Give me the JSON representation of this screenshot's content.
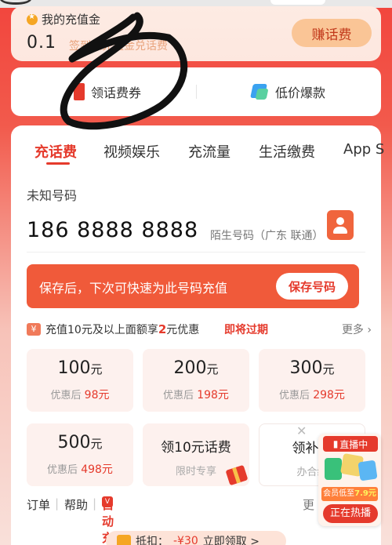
{
  "wallet": {
    "title": "我的充值金",
    "amount": "0.1",
    "hint": "签到领充值金兑话费",
    "earn_button": "赚话费"
  },
  "quick_links": [
    {
      "label": "领话费券",
      "icon": "coupon-icon"
    },
    {
      "label": "低价爆款",
      "icon": "deals-icon"
    }
  ],
  "tabs": [
    "充话费",
    "视频娱乐",
    "充流量",
    "生活缴费",
    "App S"
  ],
  "active_tab": 0,
  "phone": {
    "label": "未知号码",
    "number": "186 8888 8888",
    "carrier": "陌生号码（广东 联通）"
  },
  "save_banner": {
    "text": "保存后，下次可快速为此号码充值",
    "button": "保存号码"
  },
  "promo": {
    "tag": "¥",
    "text_before": "充值10元及以上面额享",
    "highlight": "2",
    "text_after": "元优惠",
    "expire": "即将过期",
    "more": "更多"
  },
  "amounts": [
    {
      "value": "100",
      "unit": "元",
      "sub_label": "优惠后",
      "price": "98元"
    },
    {
      "value": "200",
      "unit": "元",
      "sub_label": "优惠后",
      "price": "198元"
    },
    {
      "value": "300",
      "unit": "元",
      "sub_label": "优惠后",
      "price": "298元"
    },
    {
      "value": "500",
      "unit": "元",
      "sub_label": "优惠后",
      "price": "498元"
    }
  ],
  "special_cards": [
    {
      "title": "领10元话费",
      "subtitle": "限时专享"
    },
    {
      "title": "领补贴",
      "subtitle": "办合约"
    }
  ],
  "bottom_links": {
    "orders": "订单",
    "help": "帮助",
    "auto": "自动充值",
    "auto_badge": "V",
    "more": "更"
  },
  "coupon_strip": {
    "prefix": "抵扣：",
    "price": "-¥30",
    "suffix": "立即领取 >"
  },
  "live": {
    "status": "直播中",
    "caption_prefix": "会员低至",
    "caption_amount": "7.9元",
    "button": "正在热播"
  },
  "colors": {
    "accent": "#e53a2c",
    "banner": "#f05a3a",
    "earn_button_bg": "#fac596"
  }
}
